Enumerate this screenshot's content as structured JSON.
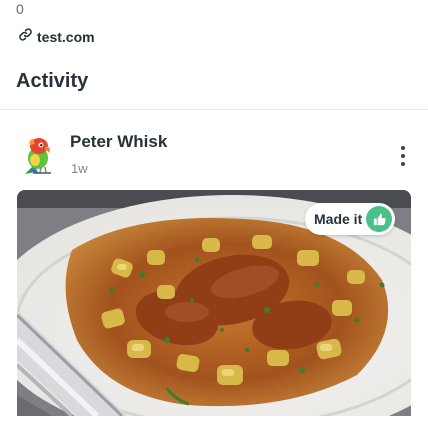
{
  "profile": {
    "count": "0",
    "website": "test.com"
  },
  "activity": {
    "title": "Activity"
  },
  "post": {
    "author": "Peter Whisk",
    "time": "1w",
    "badge_label": "Made it",
    "icons": {
      "link": "link-icon",
      "menu": "more-vertical-icon",
      "badge": "thumbs-up-icon"
    },
    "colors": {
      "badge": "#48c28a"
    }
  }
}
